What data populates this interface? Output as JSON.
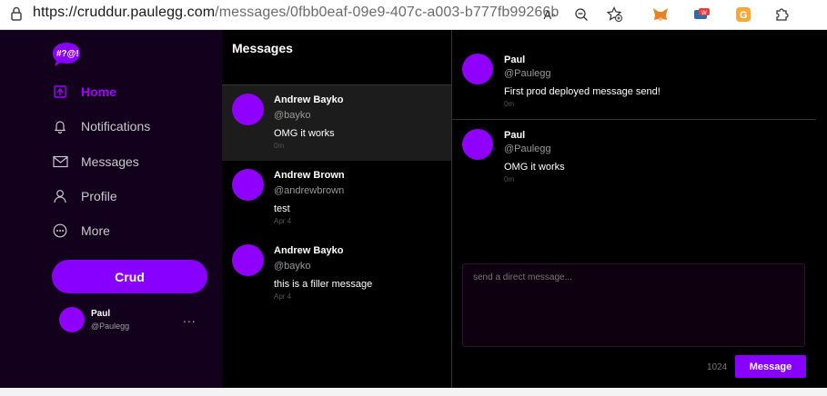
{
  "browser": {
    "url_host": "https://cruddur.paulegg.com",
    "url_rest": "/messages/0fbb0eaf-09e9-407c-a003-b777fb99266b",
    "icons": [
      "read-aloud-icon",
      "zoom-icon",
      "favorites-icon",
      "metamask-extension-icon",
      "extension-icon",
      "grammarly-icon",
      "extensions-puzzle-icon"
    ]
  },
  "sidebar": {
    "logo_text": "#?@!",
    "items": [
      {
        "label": "Home",
        "icon": "home-icon",
        "active": true
      },
      {
        "label": "Notifications",
        "icon": "bell-icon",
        "active": false
      },
      {
        "label": "Messages",
        "icon": "envelope-icon",
        "active": false
      },
      {
        "label": "Profile",
        "icon": "user-icon",
        "active": false
      },
      {
        "label": "More",
        "icon": "more-circle-icon",
        "active": false
      }
    ],
    "crud_button": "Crud",
    "profile": {
      "name": "Paul",
      "handle": "@Paulegg",
      "more": "..."
    }
  },
  "messages": {
    "title": "Messages",
    "conversations": [
      {
        "name": "Andrew Bayko",
        "handle": "@bayko",
        "message": "OMG it works",
        "time": "0m"
      },
      {
        "name": "Andrew Brown",
        "handle": "@andrewbrown",
        "message": "test",
        "time": "Apr 4"
      },
      {
        "name": "Andrew Bayko",
        "handle": "@bayko",
        "message": "this is a filler message",
        "time": "Apr 4"
      }
    ]
  },
  "thread": {
    "messages": [
      {
        "name": "Paul",
        "handle": "@Paulegg",
        "message": "First prod deployed message send!",
        "time": "0m"
      },
      {
        "name": "Paul",
        "handle": "@Paulegg",
        "message": "OMG it works",
        "time": "0m"
      }
    ],
    "compose_placeholder": "send a direct message...",
    "char_count": "1024",
    "send_button": "Message"
  },
  "colors": {
    "accent": "#8800ff",
    "sidebar_bg": "#12001d",
    "active_nav": "#a000ff"
  }
}
